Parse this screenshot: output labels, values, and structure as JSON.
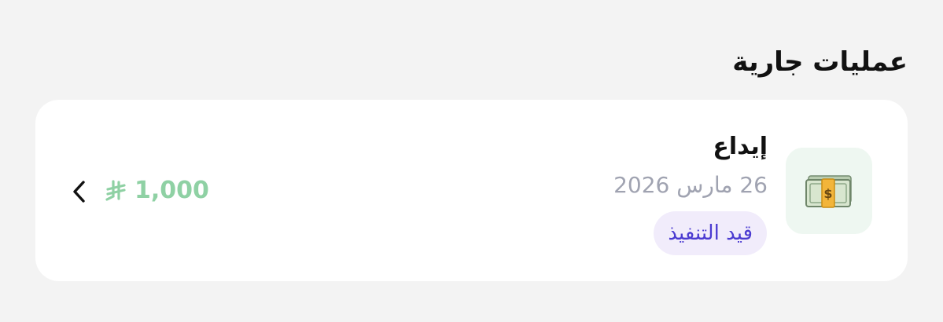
{
  "section": {
    "title": "عمليات جارية"
  },
  "transaction": {
    "icon": "dollar-banknote-icon",
    "title": "إيداع",
    "date": "26 مارس 2026",
    "status": "قيد التنفيذ",
    "amount": "1,000",
    "currency_icon": "saudi-riyal-icon"
  },
  "colors": {
    "page_bg": "#f3f3f3",
    "card_bg": "#ffffff",
    "icon_tile_bg": "#eef7f1",
    "amount": "#8fd1a4",
    "status_bg": "#f1ecfb",
    "status_text": "#4b3bd1",
    "date_text": "#a0a3b1"
  }
}
